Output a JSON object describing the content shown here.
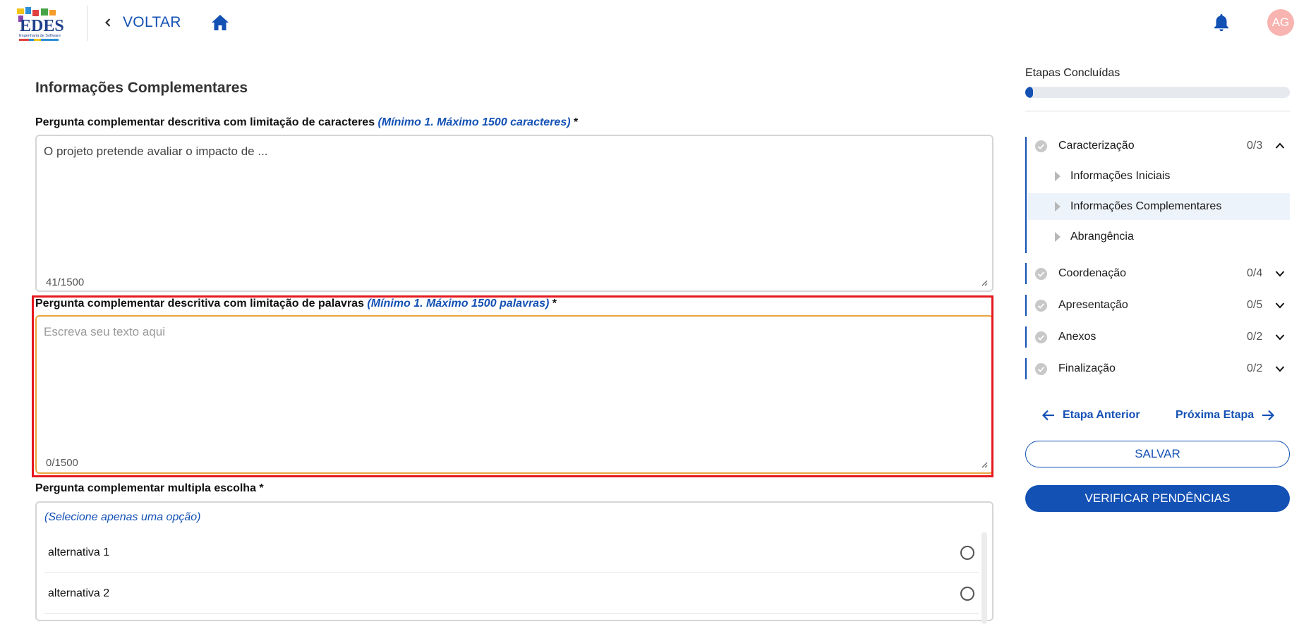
{
  "header": {
    "logo_text": "EDES",
    "logo_subtext": "Engenharia de Software",
    "back_label": "VOLTAR",
    "avatar_initials": "AG"
  },
  "main": {
    "section_title": "Informações Complementares",
    "questions": [
      {
        "label": "Pergunta complementar descritiva com limitação de caracteres",
        "hint": "(Mínimo 1. Máximo 1500 caracteres)",
        "required": "*",
        "value": "O projeto pretende avaliar o impacto de ...",
        "counter": "41/1500"
      },
      {
        "label": "Pergunta complementar descritiva com limitação de palavras",
        "hint": "(Mínimo 1. Máximo 1500 palavras)",
        "required": "*",
        "placeholder": "Escreva seu texto aqui",
        "counter": "0/1500"
      },
      {
        "label": "Pergunta complementar multipla escolha",
        "required": "*",
        "hint": "(Selecione apenas uma opção)",
        "options": [
          "alternativa 1",
          "alternativa 2"
        ]
      }
    ]
  },
  "sidebar": {
    "progress_title": "Etapas Concluídas",
    "progress_fraction": 0.03,
    "steps": [
      {
        "name": "Caracterização",
        "count": "0/3",
        "expanded": true
      },
      {
        "name": "Coordenação",
        "count": "0/4"
      },
      {
        "name": "Apresentação",
        "count": "0/5"
      },
      {
        "name": "Anexos",
        "count": "0/2"
      },
      {
        "name": "Finalização",
        "count": "0/2"
      }
    ],
    "substeps": [
      "Informações Iniciais",
      "Informações Complementares",
      "Abrangência"
    ],
    "active_substep": "Informações Complementares",
    "prev_label": "Etapa Anterior",
    "next_label": "Próxima Etapa",
    "save_label": "SALVAR",
    "verify_label": "VERIFICAR PENDÊNCIAS"
  },
  "colors": {
    "primary": "#1351b4",
    "highlight": "#e6191e",
    "focus": "#e8a33c",
    "avatar": "#f8b4b0"
  }
}
